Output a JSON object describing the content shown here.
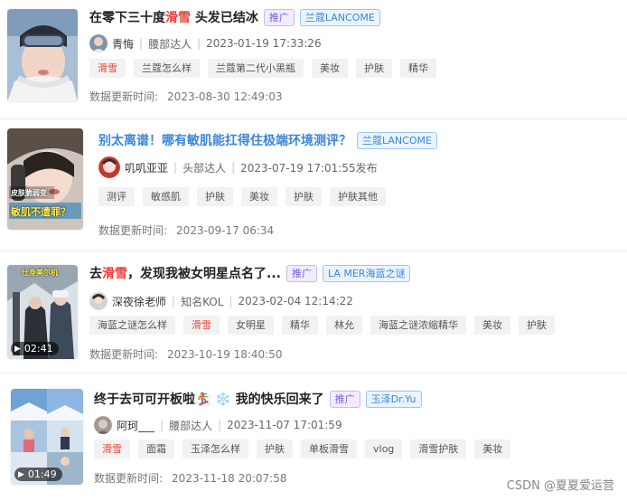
{
  "posts": [
    {
      "title_before": "在零下三十度",
      "title_highlight": "滑雪",
      "title_after": " 头发已结冰",
      "badges": [
        "推广",
        "兰蔻LANCOME"
      ],
      "author": "青悔",
      "author_level": "腰部达人",
      "publish_time": "2023-01-19 17:33:26",
      "tags": [
        "滑雪",
        "兰蔻怎么样",
        "兰蔻第二代小黑瓶",
        "美妆",
        "护肤",
        "精华"
      ],
      "update_label": "数据更新时间:",
      "update_time": "2023-08-30 12:49:03"
    },
    {
      "title": "别太离谱！哪有敏肌能扛得住极端环境测评？",
      "badges": [
        "兰蔻LANCOME"
      ],
      "author": "叽叽亚亚",
      "author_level": "头部达人",
      "publish_time": "2023-07-19 17:01:55发布",
      "tags": [
        "测评",
        "敏感肌",
        "护肤",
        "美妆",
        "护肤",
        "护肤其他"
      ],
      "update_label": "数据更新时间:",
      "update_time": "2023-09-17 06:34",
      "thumb_text_1": "皮肤脆弱变",
      "thumb_text_2": "敏肌不遭罪？"
    },
    {
      "title_before": "去",
      "title_highlight": "滑雪",
      "title_after": "，发现我被女明星点名了...",
      "badges": [
        "推广",
        "LA MER海蓝之谜"
      ],
      "author": "深夜徐老师",
      "author_level": "知名KOL",
      "publish_time": "2023-02-04 12:14:22",
      "tags": [
        "海蓝之谜怎么样",
        "滑雪",
        "女明星",
        "精华",
        "林允",
        "海蓝之谜浓缩精华",
        "美妆",
        "护肤"
      ],
      "update_label": "数据更新时间:",
      "update_time": "2023-10-19 18:40:50",
      "duration": "02:41",
      "thumb_text_1": "仕身美尔机"
    },
    {
      "title": "终于去可可开板啦🏂 ❄️ 我的快乐回来了",
      "badges": [
        "推广",
        "玉泽Dr.Yu"
      ],
      "author": "阿珂___",
      "author_level": "腰部达人",
      "publish_time": "2023-11-07 17:01:59",
      "tags": [
        "滑雪",
        "面霜",
        "玉泽怎么样",
        "护肤",
        "单板滑雪",
        "vlog",
        "滑雪护肤",
        "美妆"
      ],
      "update_label": "数据更新时间:",
      "update_time": "2023-11-18 20:07:58",
      "duration": "01:49"
    }
  ],
  "watermark": "CSDN @夏夏爱运营",
  "colors": {
    "highlight": "#e8413c",
    "blue_title": "#3b86d8",
    "promo_badge": "#7a5bd6",
    "brand_badge": "#3b86d8"
  }
}
